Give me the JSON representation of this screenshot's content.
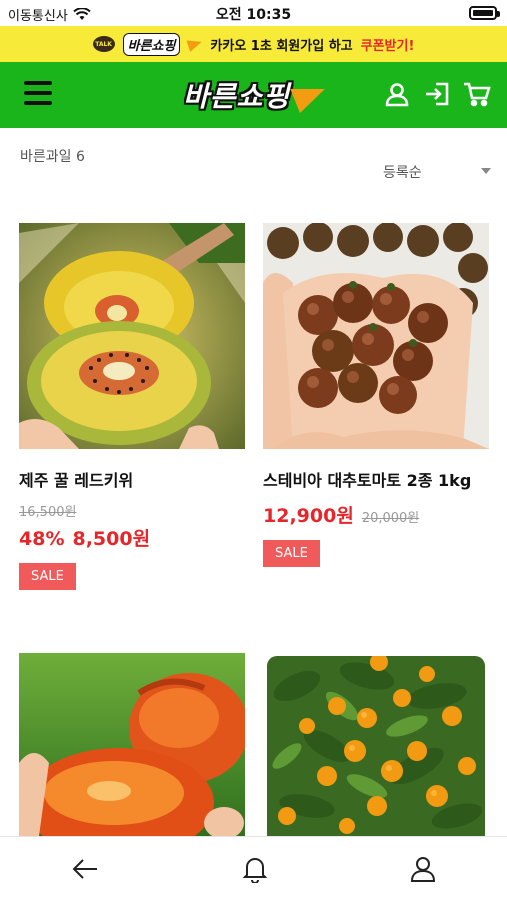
{
  "status_bar": {
    "carrier": "이동통신사",
    "time": "오전 10:35"
  },
  "promo": {
    "talk": "TALK",
    "logo": "바른쇼핑",
    "text": "카카오 1초 회원가입 하고",
    "cta": "쿠폰받기!"
  },
  "header": {
    "logo": "바른쇼핑",
    "icons": [
      "menu-icon",
      "user-icon",
      "login-icon",
      "cart-icon"
    ]
  },
  "listing": {
    "category": "바른과일 6",
    "sort": {
      "selected": "등록순"
    }
  },
  "products": [
    {
      "name": "제주 꿀 레드키위",
      "original_price": "16,500원",
      "discount": "48%",
      "sale_price": "8,500원",
      "badge": "SALE"
    },
    {
      "name": "스테비아 대추토마토 2종 1kg",
      "original_price": "20,000원",
      "sale_price": "12,900원",
      "badge": "SALE"
    },
    {
      "name": "",
      "original_price": "",
      "sale_price": ""
    },
    {
      "name": "",
      "original_price": "",
      "sale_price": ""
    }
  ],
  "bottom_nav": {
    "icons": [
      "back-icon",
      "bell-icon",
      "user-icon"
    ]
  },
  "colors": {
    "header": "#1ab51a",
    "promo": "#f7ea38",
    "price": "#e5272b",
    "badge": "#f05a5a"
  }
}
